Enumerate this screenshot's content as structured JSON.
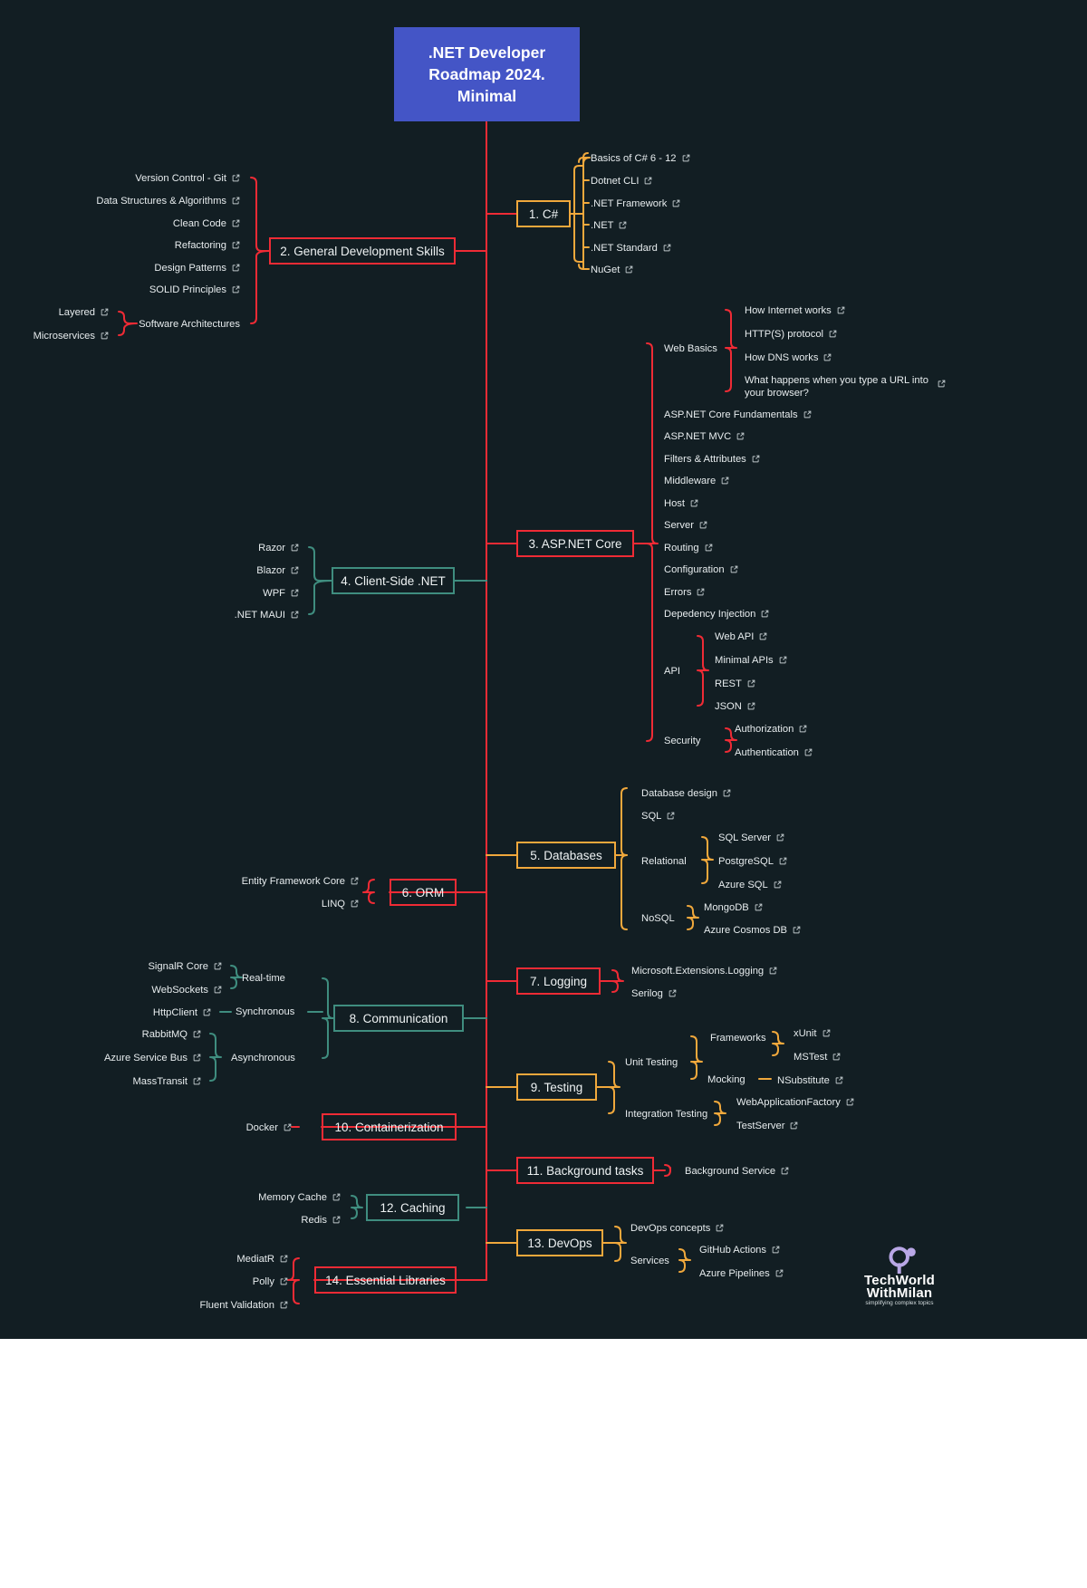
{
  "meta": {
    "background": "#121e23",
    "title_box_color": "#4455c6",
    "red": "#ef2b35",
    "orange": "#f0a83c",
    "teal": "#3f8d7f",
    "text": "#e7ecee"
  },
  "title": {
    "line1": ".NET Developer",
    "line2": "Roadmap 2024.",
    "line3": "Minimal"
  },
  "branches": {
    "csharp": {
      "label": "1. C#",
      "color": "#f0a83c",
      "items": [
        "Basics of C# 6 - 12",
        "Dotnet CLI",
        ".NET Framework",
        ".NET",
        ".NET Standard",
        "NuGet"
      ]
    },
    "general": {
      "label": "2. General Development Skills",
      "color": "#ef2b35",
      "items": [
        "Version Control - Git",
        "Data Structures & Algorithms",
        "Clean Code",
        "Refactoring",
        "Design Patterns",
        "SOLID Principles"
      ],
      "group": {
        "label": "Software Architectures",
        "items": [
          "Layered",
          "Microservices"
        ]
      }
    },
    "aspnet": {
      "label": "3. ASP.NET Core",
      "color": "#ef2b35",
      "web_basics": {
        "label": "Web Basics",
        "items": [
          "How Internet works",
          "HTTP(S) protocol",
          "How DNS works",
          "What happens when you type a URL into your browser?"
        ]
      },
      "items": [
        "ASP.NET Core Fundamentals",
        "ASP.NET MVC",
        "Filters & Attributes",
        "Middleware",
        "Host",
        "Server",
        "Routing",
        "Configuration",
        "Errors",
        "Depedency Injection"
      ],
      "api": {
        "label": "API",
        "items": [
          "Web API",
          "Minimal APIs",
          "REST",
          "JSON"
        ]
      },
      "security": {
        "label": "Security",
        "items": [
          "Authorization",
          "Authentication"
        ]
      }
    },
    "clientside": {
      "label": "4. Client-Side .NET",
      "color": "#3f8d7f",
      "items": [
        "Razor",
        "Blazor",
        "WPF",
        ".NET MAUI"
      ]
    },
    "databases": {
      "label": "5. Databases",
      "color": "#f0a83c",
      "items": [
        "Database design",
        "SQL"
      ],
      "relational": {
        "label": "Relational",
        "items": [
          "SQL Server",
          "PostgreSQL",
          "Azure SQL"
        ]
      },
      "nosql": {
        "label": "NoSQL",
        "items": [
          "MongoDB",
          "Azure Cosmos DB"
        ]
      }
    },
    "orm": {
      "label": "6. ORM",
      "color": "#ef2b35",
      "items": [
        "Entity Framework Core",
        "LINQ"
      ]
    },
    "logging": {
      "label": "7. Logging",
      "color": "#ef2b35",
      "items": [
        "Microsoft.Extensions.Logging",
        "Serilog"
      ]
    },
    "communication": {
      "label": "8. Communication",
      "color": "#3f8d7f",
      "realtime": {
        "label": "Real-time",
        "items": [
          "SignalR Core",
          "WebSockets"
        ]
      },
      "synchronous": {
        "label": "Synchronous",
        "items": [
          "HttpClient"
        ]
      },
      "asynchronous": {
        "label": "Asynchronous",
        "items": [
          "RabbitMQ",
          "Azure Service Bus",
          "MassTransit"
        ]
      }
    },
    "testing": {
      "label": "9. Testing",
      "color": "#f0a83c",
      "unit": {
        "label": "Unit Testing",
        "frameworks": {
          "label": "Frameworks",
          "items": [
            "xUnit",
            "MSTest"
          ]
        },
        "mocking": {
          "label": "Mocking",
          "items": [
            "NSubstitute"
          ]
        }
      },
      "integration": {
        "label": "Integration Testing",
        "items": [
          "WebApplicationFactory",
          "TestServer"
        ]
      }
    },
    "containerization": {
      "label": "10. Containerization",
      "color": "#ef2b35",
      "items": [
        "Docker"
      ]
    },
    "background": {
      "label": "11. Background tasks",
      "color": "#ef2b35",
      "items": [
        "Background Service"
      ]
    },
    "caching": {
      "label": "12. Caching",
      "color": "#3f8d7f",
      "items": [
        "Memory Cache",
        "Redis"
      ]
    },
    "devops": {
      "label": "13. DevOps",
      "color": "#f0a83c",
      "items": [
        "DevOps concepts"
      ],
      "services": {
        "label": "Services",
        "items": [
          "GitHub Actions",
          "Azure Pipelines"
        ]
      }
    },
    "libraries": {
      "label": "14. Essential Libraries",
      "color": "#ef2b35",
      "items": [
        "MediatR",
        "Polly",
        "Fluent Validation"
      ]
    }
  },
  "logo": {
    "line1": "TechWorld",
    "line2": "WithMilan",
    "tagline": "simplifying complex topics"
  }
}
